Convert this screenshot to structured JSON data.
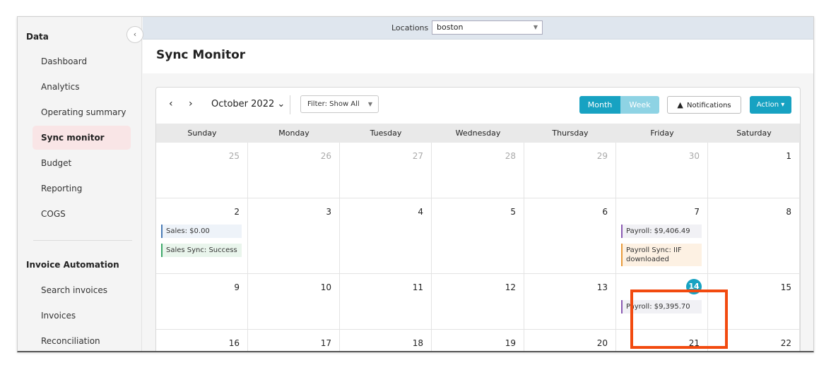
{
  "sidebar": {
    "collapse_icon": "chevron-left-icon",
    "collapse_glyph": "‹",
    "section_data": "Data",
    "data_items": [
      {
        "label": "Dashboard"
      },
      {
        "label": "Analytics"
      },
      {
        "label": "Operating summary"
      },
      {
        "label": "Sync monitor",
        "active": true
      },
      {
        "label": "Budget"
      },
      {
        "label": "Reporting"
      },
      {
        "label": "COGS"
      }
    ],
    "section_invoice": "Invoice Automation",
    "invoice_items": [
      {
        "label": "Search invoices"
      },
      {
        "label": "Invoices"
      },
      {
        "label": "Reconciliation"
      }
    ]
  },
  "topbar": {
    "locations_label": "Locations",
    "location_value": "boston",
    "location_caret": "▼"
  },
  "header": {
    "title": "Sync Monitor"
  },
  "toolbar": {
    "prev_glyph": "‹",
    "next_glyph": "›",
    "month_label": "October 2022 ⌄",
    "filter_label": "Filter: Show All",
    "filter_caret": "▼",
    "view_month": "Month",
    "view_week": "Week",
    "active_view": "Month",
    "notifications_icon": "warning-icon",
    "notifications_glyph": "▲",
    "notifications_label": "Notifications",
    "action_label": "Action ▾"
  },
  "weekdays": [
    "Sunday",
    "Monday",
    "Tuesday",
    "Wednesday",
    "Thursday",
    "Friday",
    "Saturday"
  ],
  "weeks": [
    [
      {
        "day": "25",
        "other": true
      },
      {
        "day": "26",
        "other": true
      },
      {
        "day": "27",
        "other": true
      },
      {
        "day": "28",
        "other": true
      },
      {
        "day": "29",
        "other": true
      },
      {
        "day": "30",
        "other": true
      },
      {
        "day": "1"
      }
    ],
    [
      {
        "day": "2",
        "events": [
          {
            "text": "Sales: $0.00",
            "kind": "sales"
          },
          {
            "text": "Sales Sync: Success",
            "kind": "salessync"
          }
        ]
      },
      {
        "day": "3"
      },
      {
        "day": "4"
      },
      {
        "day": "5"
      },
      {
        "day": "6"
      },
      {
        "day": "7",
        "events": [
          {
            "text": "Payroll: $9,406.49",
            "kind": "payroll"
          },
          {
            "text": "Payroll Sync: IIF downloaded",
            "kind": "payrollsync"
          }
        ]
      },
      {
        "day": "8"
      }
    ],
    [
      {
        "day": "9"
      },
      {
        "day": "10"
      },
      {
        "day": "11"
      },
      {
        "day": "12"
      },
      {
        "day": "13"
      },
      {
        "day": "14",
        "today": true,
        "highlighted": true,
        "events": [
          {
            "text": "Payroll: $9,395.70",
            "kind": "payroll"
          }
        ]
      },
      {
        "day": "15"
      }
    ],
    [
      {
        "day": "16"
      },
      {
        "day": "17"
      },
      {
        "day": "18"
      },
      {
        "day": "19"
      },
      {
        "day": "20"
      },
      {
        "day": "21"
      },
      {
        "day": "22"
      }
    ]
  ]
}
